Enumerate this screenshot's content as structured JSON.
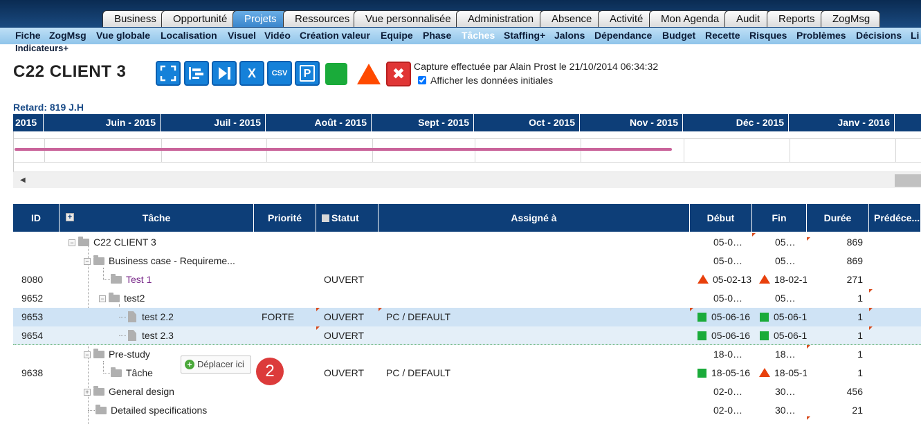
{
  "top_tabs": [
    {
      "label": "Business"
    },
    {
      "label": "Opportunité"
    },
    {
      "label": "Projets",
      "active": true
    },
    {
      "label": "Ressources"
    },
    {
      "label": "Vue personnalisée"
    },
    {
      "label": "Administration"
    },
    {
      "label": "Absence"
    },
    {
      "label": "Activité"
    },
    {
      "label": "Mon Agenda"
    },
    {
      "label": "Audit"
    },
    {
      "label": "Reports"
    },
    {
      "label": "ZogMsg"
    }
  ],
  "sub_nav": [
    {
      "label": "Fiche"
    },
    {
      "label": "ZogMsg"
    },
    {
      "label": "Vue globale"
    },
    {
      "label": "Localisation"
    },
    {
      "label": "Visuel"
    },
    {
      "label": "Vidéo"
    },
    {
      "label": "Création valeur"
    },
    {
      "label": "Equipe"
    },
    {
      "label": "Phase"
    },
    {
      "label": "Tâches",
      "active": true
    },
    {
      "label": "Staffing+"
    },
    {
      "label": "Jalons"
    },
    {
      "label": "Dépendance"
    },
    {
      "label": "Budget"
    },
    {
      "label": "Recette"
    },
    {
      "label": "Risques"
    },
    {
      "label": "Problèmes"
    },
    {
      "label": "Décisions"
    },
    {
      "label": "Li"
    }
  ],
  "sub_nav_row2": "Indicateurs+",
  "project_title": "C22 CLIENT 3",
  "toolbar": {
    "icons": [
      "fullscreen-icon",
      "gantt-icon",
      "next-end-icon",
      "excel-icon",
      "csv-icon",
      "pdf-icon",
      "status-green-icon",
      "status-red-triangle-icon",
      "close-red-icon"
    ],
    "pdf_letter": "P",
    "csv_letter": "CSV",
    "excel_letter": "X",
    "close_glyph": "✖"
  },
  "capture_text": "Capture effectuée par Alain Prost le 21/10/2014 06:34:32",
  "show_initial_label": "Afficher les données initiales",
  "show_initial_checked": true,
  "delay_text": "Retard: 819 J.H",
  "gantt_months": [
    "2015",
    "Juin - 2015",
    "Juil - 2015",
    "Août - 2015",
    "Sept - 2015",
    "Oct - 2015",
    "Nov - 2015",
    "Déc - 2015",
    "Janv - 2016"
  ],
  "table_headers": {
    "id": "ID",
    "task": "Tâche",
    "priority": "Priorité",
    "status": "Statut",
    "assigned": "Assigné à",
    "start": "Début",
    "end": "Fin",
    "duration": "Durée",
    "pred": "Prédéce..."
  },
  "rows": [
    {
      "id": "",
      "task": "C22 CLIENT 3",
      "priority": "",
      "status": "",
      "assigned": "",
      "start": "05-0…",
      "end": "05…",
      "duration": "869"
    },
    {
      "id": "",
      "task": "Business case - Requireme...",
      "priority": "",
      "status": "",
      "assigned": "",
      "start": "05-0…",
      "end": "05…",
      "duration": "869"
    },
    {
      "id": "8080",
      "task": "Test 1",
      "priority": "",
      "status": "OUVERT",
      "assigned": "",
      "start": "05-02-13",
      "end": "18-02-1",
      "duration": "271"
    },
    {
      "id": "9652",
      "task": "test2",
      "priority": "",
      "status": "",
      "assigned": "",
      "start": "05-0…",
      "end": "05…",
      "duration": "1"
    },
    {
      "id": "9653",
      "task": "test 2.2",
      "priority": "FORTE",
      "status": "OUVERT",
      "assigned": "PC / DEFAULT",
      "start": "05-06-16",
      "end": "05-06-1",
      "duration": "1"
    },
    {
      "id": "9654",
      "task": "test 2.3",
      "priority": "",
      "status": "OUVERT",
      "assigned": "",
      "start": "05-06-16",
      "end": "05-06-1",
      "duration": "1"
    },
    {
      "id": "",
      "task": "Pre-study",
      "priority": "",
      "status": "",
      "assigned": "",
      "start": "18-0…",
      "end": "18…",
      "duration": "1"
    },
    {
      "id": "9638",
      "task": "Tâche",
      "priority": "",
      "status": "OUVERT",
      "assigned": "PC / DEFAULT",
      "start": "18-05-16",
      "end": "18-05-1",
      "duration": "1"
    },
    {
      "id": "",
      "task": "General design",
      "priority": "",
      "status": "",
      "assigned": "",
      "start": "02-0…",
      "end": "30…",
      "duration": "456"
    },
    {
      "id": "",
      "task": "Detailed specifications",
      "priority": "",
      "status": "",
      "assigned": "",
      "start": "02-0…",
      "end": "30…",
      "duration": "21"
    }
  ],
  "move_here_label": "Déplacer ici",
  "step_badge": "2",
  "colors": {
    "header_blue": "#0d3e78",
    "accent_pink": "#c9639a",
    "status_green": "#1aab3a",
    "status_red": "#e8400c"
  }
}
